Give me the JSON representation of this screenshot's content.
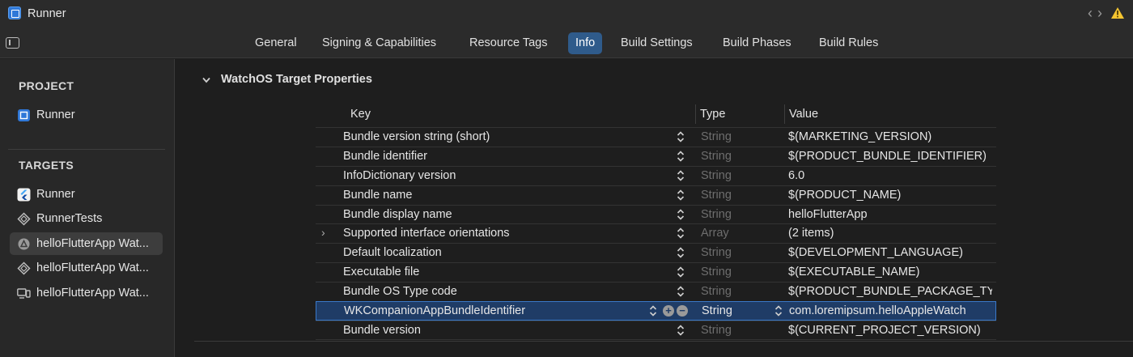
{
  "window": {
    "title": "Runner"
  },
  "tabs": [
    {
      "label": "General",
      "active": false
    },
    {
      "label": "Signing & Capabilities",
      "active": false
    },
    {
      "label": "Resource Tags",
      "active": false
    },
    {
      "label": "Info",
      "active": true
    },
    {
      "label": "Build Settings",
      "active": false
    },
    {
      "label": "Build Phases",
      "active": false
    },
    {
      "label": "Build Rules",
      "active": false
    }
  ],
  "sidebar": {
    "project_header": "PROJECT",
    "project_items": [
      {
        "label": "Runner",
        "icon": "xcode-project-icon"
      }
    ],
    "targets_header": "TARGETS",
    "target_items": [
      {
        "label": "Runner",
        "icon": "flutter-icon",
        "selected": false
      },
      {
        "label": "RunnerTests",
        "icon": "test-bundle-icon",
        "selected": false
      },
      {
        "label": "helloFlutterApp Wat...",
        "icon": "watch-app-icon",
        "selected": true
      },
      {
        "label": "helloFlutterApp Wat...",
        "icon": "test-bundle-icon",
        "selected": false
      },
      {
        "label": "helloFlutterApp Wat...",
        "icon": "ui-test-icon",
        "selected": false
      }
    ]
  },
  "main": {
    "section_title": "WatchOS Target Properties",
    "columns": {
      "key": "Key",
      "type": "Type",
      "value": "Value"
    },
    "rows": [
      {
        "key": "Bundle version string (short)",
        "type": "String",
        "value": "$(MARKETING_VERSION)"
      },
      {
        "key": "Bundle identifier",
        "type": "String",
        "value": "$(PRODUCT_BUNDLE_IDENTIFIER)"
      },
      {
        "key": "InfoDictionary version",
        "type": "String",
        "value": "6.0"
      },
      {
        "key": "Bundle name",
        "type": "String",
        "value": "$(PRODUCT_NAME)"
      },
      {
        "key": "Bundle display name",
        "type": "String",
        "value": "helloFlutterApp"
      },
      {
        "key": "Supported interface orientations",
        "type": "Array",
        "value": "(2 items)",
        "expandable": true
      },
      {
        "key": "Default localization",
        "type": "String",
        "value": "$(DEVELOPMENT_LANGUAGE)"
      },
      {
        "key": "Executable file",
        "type": "String",
        "value": "$(EXECUTABLE_NAME)"
      },
      {
        "key": "Bundle OS Type code",
        "type": "String",
        "value": "$(PRODUCT_BUNDLE_PACKAGE_TY"
      },
      {
        "key": "WKCompanionAppBundleIdentifier",
        "type": "String",
        "value": "com.loremipsum.helloAppleWatch",
        "selected": true
      },
      {
        "key": "Bundle version",
        "type": "String",
        "value": "$(CURRENT_PROJECT_VERSION)"
      }
    ]
  },
  "colors": {
    "accent": "#2f5b8b",
    "selection": "#1f3c66",
    "warning": "#f4c430"
  }
}
